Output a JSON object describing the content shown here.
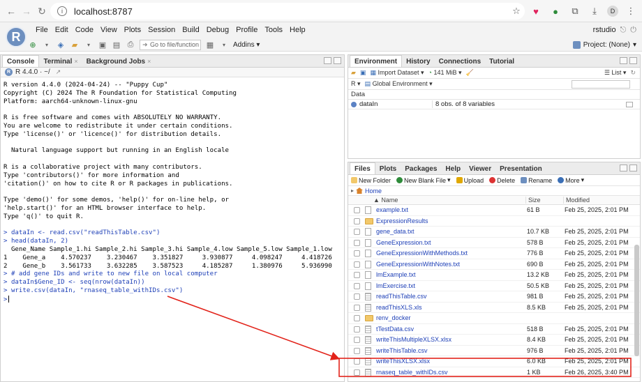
{
  "browser": {
    "url": "localhost:8787",
    "profile_initial": "D"
  },
  "menu": {
    "logo": "R",
    "items": [
      "File",
      "Edit",
      "Code",
      "View",
      "Plots",
      "Session",
      "Build",
      "Debug",
      "Profile",
      "Tools",
      "Help"
    ],
    "user": "rstudio",
    "project": "Project: (None)"
  },
  "toolbar": {
    "goto_placeholder": "Go to file/function",
    "addins": "Addins"
  },
  "console": {
    "tabs": [
      "Console",
      "Terminal",
      "Background Jobs"
    ],
    "version": "R 4.4.0 · ~/",
    "lines": [
      {
        "t": "R version 4.4.0 (2024-04-24) -- \"Puppy Cup\"",
        "k": "out"
      },
      {
        "t": "Copyright (C) 2024 The R Foundation for Statistical Computing",
        "k": "out"
      },
      {
        "t": "Platform: aarch64-unknown-linux-gnu",
        "k": "out"
      },
      {
        "t": "",
        "k": "out"
      },
      {
        "t": "R is free software and comes with ABSOLUTELY NO WARRANTY.",
        "k": "out"
      },
      {
        "t": "You are welcome to redistribute it under certain conditions.",
        "k": "out"
      },
      {
        "t": "Type 'license()' or 'licence()' for distribution details.",
        "k": "out"
      },
      {
        "t": "",
        "k": "out"
      },
      {
        "t": "  Natural language support but running in an English locale",
        "k": "out"
      },
      {
        "t": "",
        "k": "out"
      },
      {
        "t": "R is a collaborative project with many contributors.",
        "k": "out"
      },
      {
        "t": "Type 'contributors()' for more information and",
        "k": "out"
      },
      {
        "t": "'citation()' on how to cite R or R packages in publications.",
        "k": "out"
      },
      {
        "t": "",
        "k": "out"
      },
      {
        "t": "Type 'demo()' for some demos, 'help()' for on-line help, or",
        "k": "out"
      },
      {
        "t": "'help.start()' for an HTML browser interface to help.",
        "k": "out"
      },
      {
        "t": "Type 'q()' to quit R.",
        "k": "out"
      },
      {
        "t": "",
        "k": "out"
      },
      {
        "t": "> dataIn <- read.csv(\"readThisTable.csv\")",
        "k": "cmd"
      },
      {
        "t": "> head(dataIn, 2)",
        "k": "cmd"
      },
      {
        "t": "  Gene_Name Sample_1.hi Sample_2.hi Sample_3.hi Sample_4.low Sample_5.low Sample_1.low",
        "k": "out"
      },
      {
        "t": "1    Gene_a    4.570237    3.230467    3.351827     3.930877     4.098247     4.418726",
        "k": "out"
      },
      {
        "t": "2    Gene_b    3.561733    3.632285    3.587523     4.185287     1.380976     5.936990",
        "k": "out"
      },
      {
        "t": "> # add gene IDs and write to new file on local computer",
        "k": "cmd"
      },
      {
        "t": "> dataIn$Gene_ID <- seq(nrow(dataIn))",
        "k": "cmd"
      },
      {
        "t": "> write.csv(dataIn, \"rnaseq_table_withIDs.csv\")",
        "k": "cmd"
      },
      {
        "t": ">",
        "k": "prompt"
      }
    ]
  },
  "environment": {
    "tabs": [
      "Environment",
      "History",
      "Connections",
      "Tutorial"
    ],
    "import_label": "Import Dataset",
    "memory": "141 MiB",
    "list_label": "List",
    "language": "R",
    "scope": "Global Environment",
    "section": "Data",
    "rows": [
      {
        "name": "dataIn",
        "value": "8 obs. of 8 variables"
      }
    ]
  },
  "files": {
    "tabs": [
      "Files",
      "Plots",
      "Packages",
      "Help",
      "Viewer",
      "Presentation"
    ],
    "toolbar": {
      "new_folder": "New Folder",
      "new_blank": "New Blank File",
      "upload": "Upload",
      "delete": "Delete",
      "rename": "Rename",
      "more": "More"
    },
    "breadcrumb": "Home",
    "headers": {
      "name": "Name",
      "size": "Size",
      "modified": "Modified"
    },
    "rows": [
      {
        "name": "example.txt",
        "size": "61 B",
        "modified": "Feb 25, 2025, 2:01 PM",
        "type": "file"
      },
      {
        "name": "ExpressionResults",
        "size": "",
        "modified": "",
        "type": "folder"
      },
      {
        "name": "gene_data.txt",
        "size": "10.7 KB",
        "modified": "Feb 25, 2025, 2:01 PM",
        "type": "file"
      },
      {
        "name": "GeneExpression.txt",
        "size": "578 B",
        "modified": "Feb 25, 2025, 2:01 PM",
        "type": "file"
      },
      {
        "name": "GeneExpressionWithMethods.txt",
        "size": "776 B",
        "modified": "Feb 25, 2025, 2:01 PM",
        "type": "file"
      },
      {
        "name": "GeneExpressionWithNotes.txt",
        "size": "690 B",
        "modified": "Feb 25, 2025, 2:01 PM",
        "type": "file"
      },
      {
        "name": "lmExample.txt",
        "size": "13.2 KB",
        "modified": "Feb 25, 2025, 2:01 PM",
        "type": "file"
      },
      {
        "name": "lmExercise.txt",
        "size": "50.5 KB",
        "modified": "Feb 25, 2025, 2:01 PM",
        "type": "file"
      },
      {
        "name": "readThisTable.csv",
        "size": "981 B",
        "modified": "Feb 25, 2025, 2:01 PM",
        "type": "table"
      },
      {
        "name": "readThisXLS.xls",
        "size": "8.5 KB",
        "modified": "Feb 25, 2025, 2:01 PM",
        "type": "table"
      },
      {
        "name": "renv_docker",
        "size": "",
        "modified": "",
        "type": "folder"
      },
      {
        "name": "tTestData.csv",
        "size": "518 B",
        "modified": "Feb 25, 2025, 2:01 PM",
        "type": "table"
      },
      {
        "name": "writeThisMultipleXLSX.xlsx",
        "size": "8.4 KB",
        "modified": "Feb 25, 2025, 2:01 PM",
        "type": "table"
      },
      {
        "name": "writeThisTable.csv",
        "size": "976 B",
        "modified": "Feb 25, 2025, 2:01 PM",
        "type": "table"
      },
      {
        "name": "writeThisXLSX.xlsx",
        "size": "6.0 KB",
        "modified": "Feb 25, 2025, 2:01 PM",
        "type": "table"
      },
      {
        "name": "rnaseq_table_withIDs.csv",
        "size": "1 KB",
        "modified": "Feb 26, 2025, 3:40 PM",
        "type": "table"
      }
    ]
  },
  "annotation": {
    "color": "#e2231a"
  }
}
